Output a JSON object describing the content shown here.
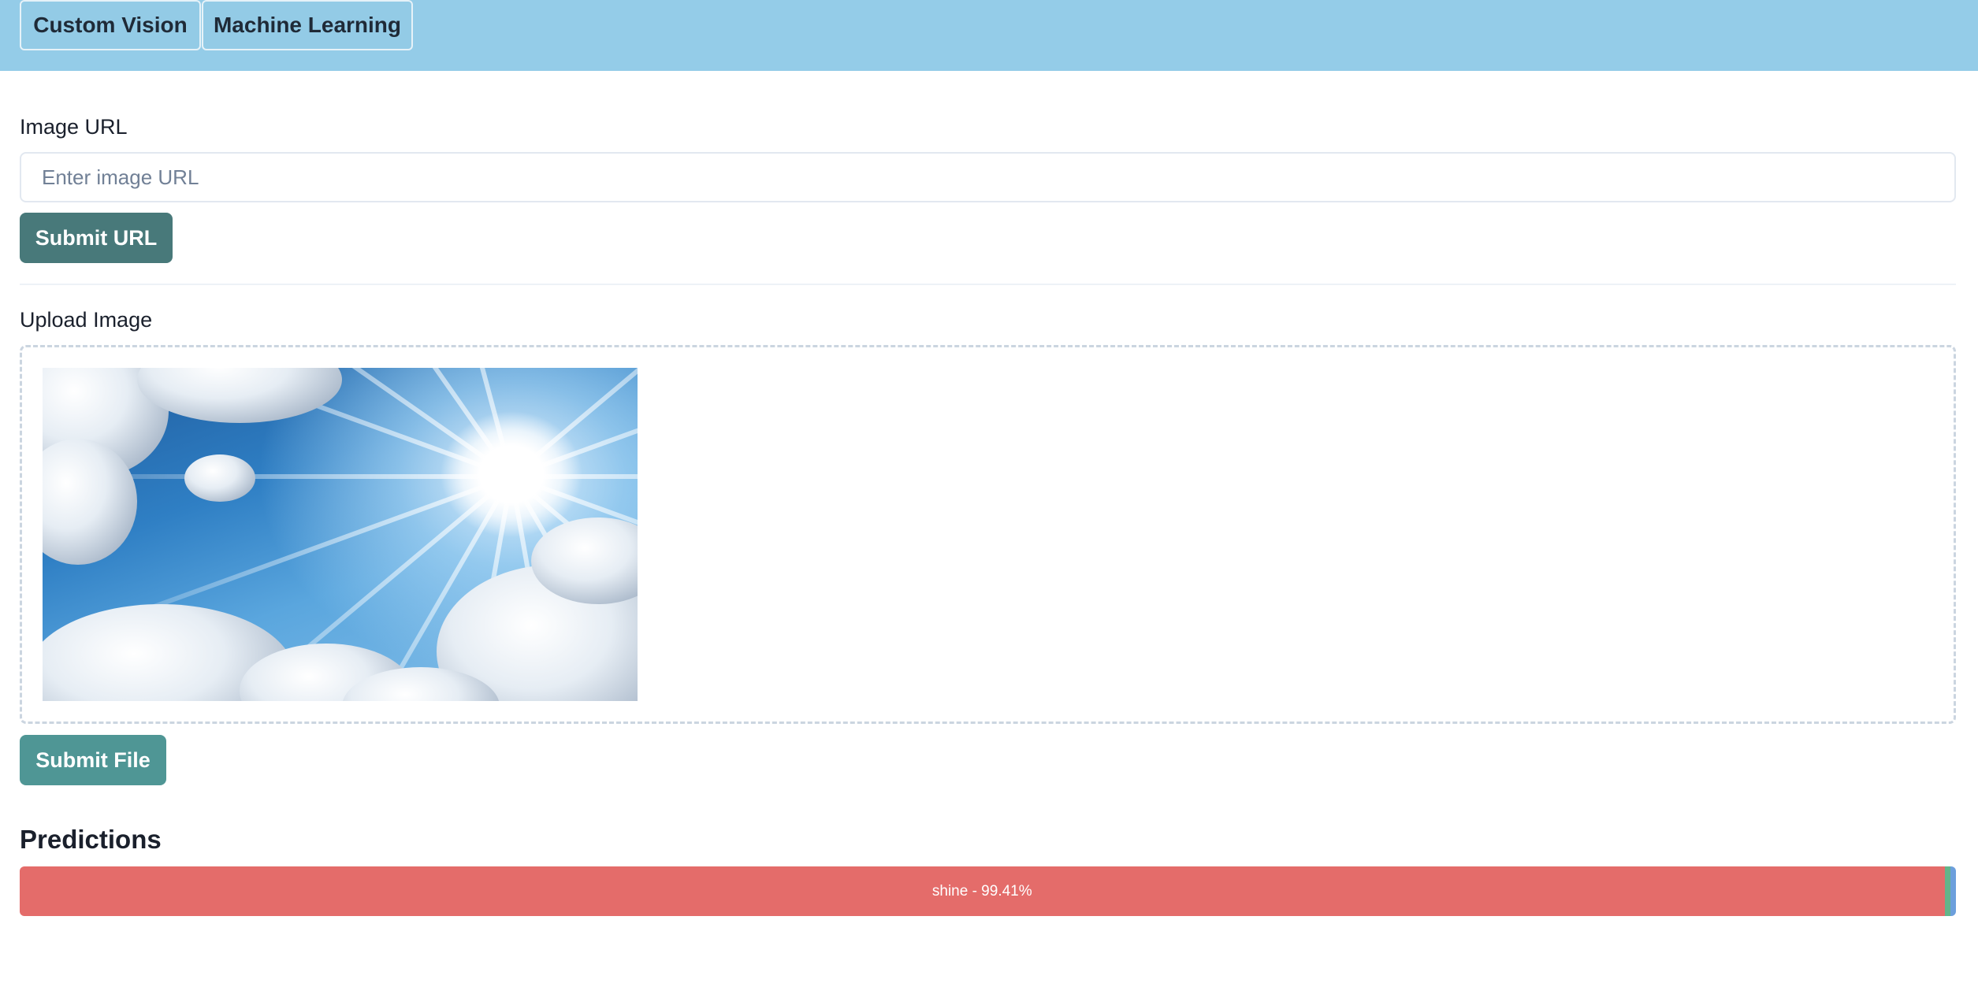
{
  "tabs": [
    {
      "label": "Custom Vision"
    },
    {
      "label": "Machine Learning"
    }
  ],
  "url_section": {
    "label": "Image URL",
    "placeholder": "Enter image URL",
    "value": "",
    "submit_label": "Submit URL"
  },
  "upload_section": {
    "label": "Upload Image",
    "submit_label": "Submit File"
  },
  "predictions": {
    "title": "Predictions",
    "items": [
      {
        "label": "shine",
        "percent": 99.41,
        "text": "shine - 99.41%",
        "color": "#e46c6a"
      },
      {
        "color": "#63b58a"
      },
      {
        "color": "#6c9fdc"
      }
    ]
  },
  "colors": {
    "header_bg": "#94cce8",
    "submit_url_bg": "#48797a",
    "submit_file_bg": "#4f9695"
  }
}
